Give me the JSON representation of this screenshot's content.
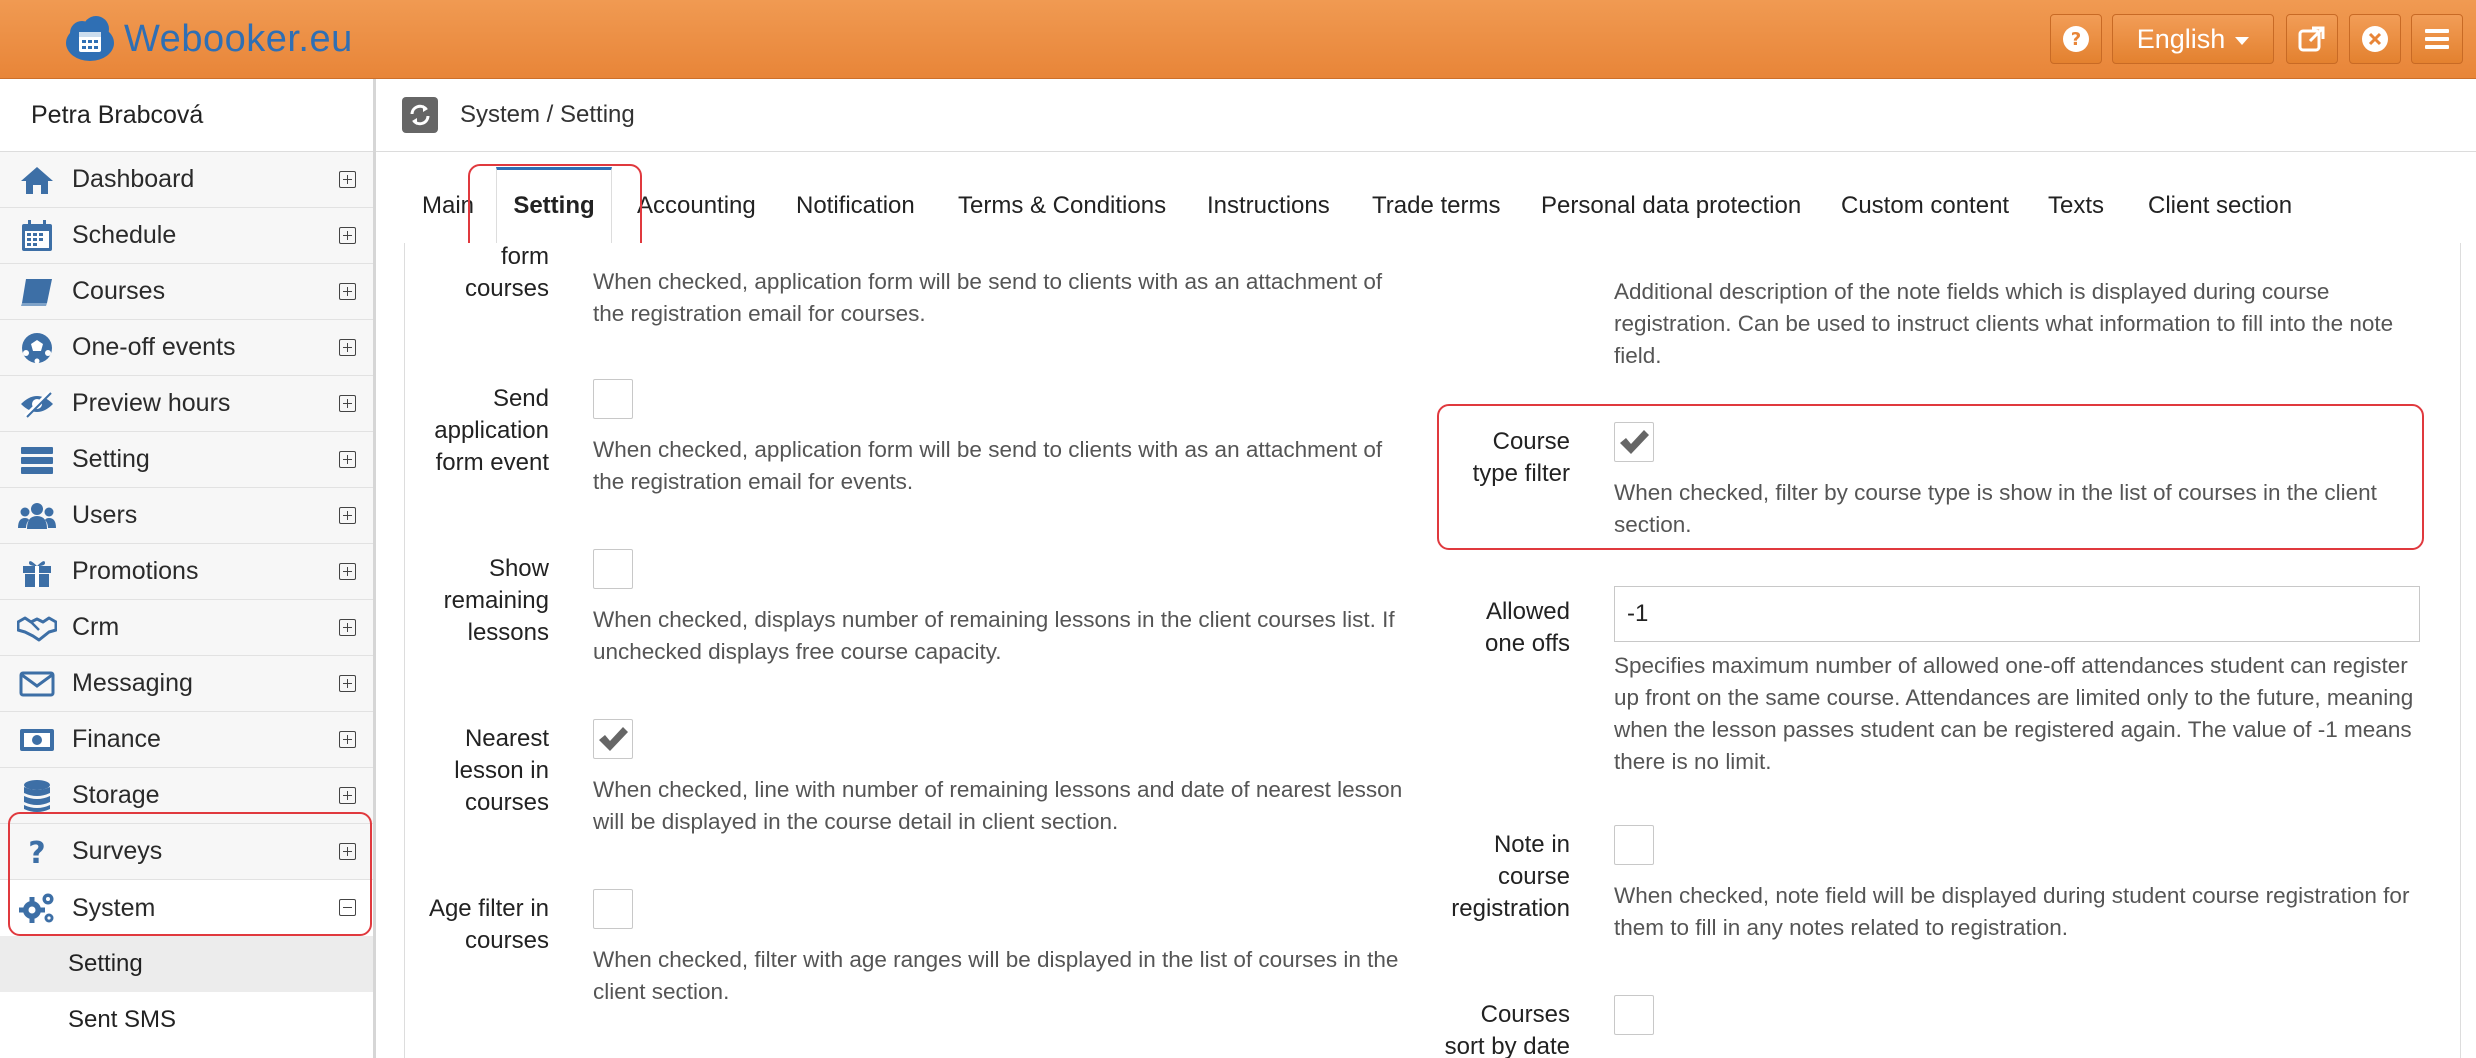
{
  "app": {
    "logo_text": "Webooker.eu"
  },
  "topbar": {
    "help_icon": "question-circle-icon",
    "language": "English",
    "external_icon": "external-link-icon",
    "close_icon": "close-circle-icon",
    "menu_icon": "hamburger-menu-icon"
  },
  "user": {
    "name": "Petra Brabcová"
  },
  "sidebar": {
    "items": [
      {
        "label": "Dashboard",
        "icon": "home-icon"
      },
      {
        "label": "Schedule",
        "icon": "calendar-icon"
      },
      {
        "label": "Courses",
        "icon": "book-icon"
      },
      {
        "label": "One-off events",
        "icon": "soccer-ball-icon"
      },
      {
        "label": "Preview hours",
        "icon": "eye-slash-icon"
      },
      {
        "label": "Setting",
        "icon": "list-icon"
      },
      {
        "label": "Users",
        "icon": "users-icon"
      },
      {
        "label": "Promotions",
        "icon": "gift-icon"
      },
      {
        "label": "Crm",
        "icon": "handshake-icon"
      },
      {
        "label": "Messaging",
        "icon": "envelope-icon"
      },
      {
        "label": "Finance",
        "icon": "money-icon"
      },
      {
        "label": "Storage",
        "icon": "database-icon"
      },
      {
        "label": "Surveys",
        "icon": "question-icon"
      },
      {
        "label": "System",
        "icon": "gears-icon",
        "expanded": true
      }
    ],
    "subitems": [
      {
        "label": "Setting",
        "active": true
      },
      {
        "label": "Sent SMS"
      }
    ]
  },
  "breadcrumb": {
    "text": "System / Setting"
  },
  "tabs": [
    {
      "label": "Main"
    },
    {
      "label": "Setting",
      "active": true
    },
    {
      "label": "Accounting"
    },
    {
      "label": "Notification"
    },
    {
      "label": "Terms & Conditions"
    },
    {
      "label": "Instructions"
    },
    {
      "label": "Trade terms"
    },
    {
      "label": "Personal data protection"
    },
    {
      "label": "Custom content"
    },
    {
      "label": "Texts"
    },
    {
      "label": "Client section"
    }
  ],
  "left_fields": [
    {
      "label": "form\ncourses",
      "checked": false,
      "description": "When checked, application form will be send to clients with as an attachment of the registration email for courses."
    },
    {
      "label": "Send\napplication\nform event",
      "checked": false,
      "description": "When checked, application form will be send to clients with as an attachment of the registration email for events."
    },
    {
      "label": "Show\nremaining\nlessons",
      "checked": false,
      "description": "When checked, displays number of remaining lessons in the client courses list. If unchecked displays free course capacity."
    },
    {
      "label": "Nearest\nlesson in\ncourses",
      "checked": true,
      "description": "When checked, line with number of remaining lessons and date of nearest lesson will be displayed in the course detail in client section."
    },
    {
      "label": "Age filter in\ncourses",
      "checked": false,
      "description": "When checked, filter with age ranges will be displayed in the list of courses in the client section."
    }
  ],
  "right_fields": {
    "note_description": "Additional description of the note fields which is displayed during course registration. Can be used to instruct clients what information to fill into the note field.",
    "course_type_filter": {
      "label": "Course\ntype filter",
      "checked": true,
      "description": "When checked, filter by course type is show in the list of courses in the client section."
    },
    "allowed_one_offs": {
      "label": "Allowed\none offs",
      "value": "-1",
      "description": "Specifies maximum number of allowed one-off attendances student can register up front on the same course. Attendances are limited only to the future, meaning when the lesson passes student can be registered again. The value of -1 means there is no limit."
    },
    "note_in_course_registration": {
      "label": "Note in\ncourse\nregistration",
      "checked": false,
      "description": "When checked, note field will be displayed during student course registration for them to fill in any notes related to registration."
    },
    "courses_sort_by_date": {
      "label": "Courses\nsort by date",
      "checked": false
    }
  },
  "colors": {
    "topbar": "#e88538",
    "logo": "#2f6fb4",
    "highlight": "#e0393e",
    "active_tab_border": "#2f6fb4"
  }
}
